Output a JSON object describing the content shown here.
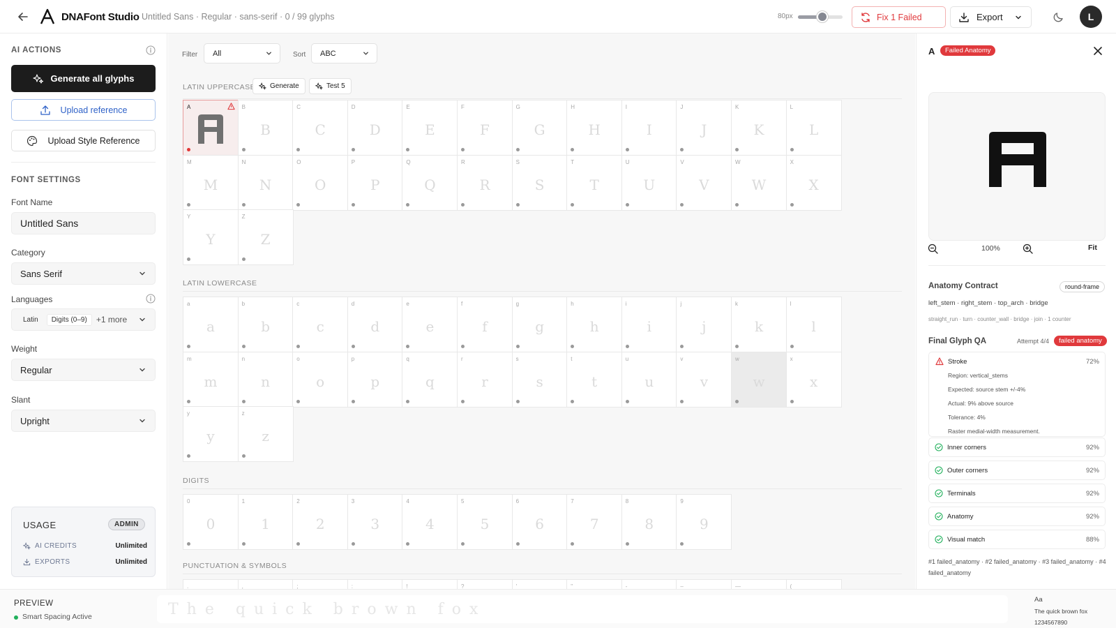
{
  "header": {
    "app_title": "DNAFont Studio",
    "doc_info": "Untitled Sans · Regular · sans-serif · 0 / 99 glyphs",
    "size_label": "80px",
    "size_fraction": 0.55,
    "fix_label": "Fix 1 Failed",
    "export_label": "Export",
    "avatar_letter": "L"
  },
  "sidebar": {
    "ai_heading": "AI ACTIONS",
    "generate_all": "Generate all glyphs",
    "upload_reference": "Upload reference",
    "upload_style": "Upload Style Reference",
    "settings_heading": "FONT SETTINGS",
    "font_name_label": "Font Name",
    "font_name_value": "Untitled Sans",
    "category_label": "Category",
    "category_value": "Sans Serif",
    "languages_label": "Languages",
    "languages_chips": [
      "Latin",
      "Digits (0–9)"
    ],
    "languages_more": "+1 more",
    "weight_label": "Weight",
    "weight_value": "Regular",
    "slant_label": "Slant",
    "slant_value": "Upright",
    "usage": {
      "title": "USAGE",
      "badge": "ADMIN",
      "credits_label": "AI CREDITS",
      "credits_value": "Unlimited",
      "exports_label": "EXPORTS",
      "exports_value": "Unlimited"
    }
  },
  "toolbar": {
    "filter_label": "Filter",
    "filter_value": "All",
    "sort_label": "Sort",
    "sort_value": "ABC"
  },
  "sections": [
    {
      "title": "LATIN UPPERCASE",
      "generate": "Generate",
      "test": "Test 5",
      "glyphs": [
        "A",
        "B",
        "C",
        "D",
        "E",
        "F",
        "G",
        "H",
        "I",
        "J",
        "K",
        "L",
        "M",
        "N",
        "O",
        "P",
        "Q",
        "R",
        "S",
        "T",
        "U",
        "V",
        "W",
        "X",
        "Y",
        "Z"
      ]
    },
    {
      "title": "LATIN LOWERCASE",
      "glyphs": [
        "a",
        "b",
        "c",
        "d",
        "e",
        "f",
        "g",
        "h",
        "i",
        "j",
        "k",
        "l",
        "m",
        "n",
        "o",
        "p",
        "q",
        "r",
        "s",
        "t",
        "u",
        "v",
        "w",
        "x",
        "y",
        "z"
      ]
    },
    {
      "title": "DIGITS",
      "glyphs": [
        "0",
        "1",
        "2",
        "3",
        "4",
        "5",
        "6",
        "7",
        "8",
        "9"
      ]
    },
    {
      "title": "PUNCTUATION & SYMBOLS",
      "glyphs": [
        ".",
        ",",
        ";",
        ":",
        "!",
        "?",
        "'",
        "\"",
        "-",
        "–",
        "—",
        "("
      ]
    }
  ],
  "panel": {
    "char": "A",
    "status_badge": "Failed Anatomy",
    "zoom_level": "100%",
    "fit": "Fit",
    "contract_title": "Anatomy Contract",
    "contract_badge": "round-frame",
    "contract_main": "left_stem · right_stem · top_arch · bridge",
    "contract_extra": "straight_run · turn · counter_wall · bridge · join · 1 counter",
    "qa_title": "Final Glyph QA",
    "qa_attempt": "Attempt 4/4",
    "qa_badge": "failed anatomy",
    "stroke": {
      "name": "Stroke",
      "score": "72%",
      "details": [
        "Region: vertical_stems",
        "Expected: source stem +/-4%",
        "Actual: 9% above source",
        "Tolerance: 4%",
        "Raster medial-width measurement."
      ]
    },
    "checks": [
      {
        "name": "Inner corners",
        "score": "92%"
      },
      {
        "name": "Outer corners",
        "score": "92%"
      },
      {
        "name": "Terminals",
        "score": "92%"
      },
      {
        "name": "Anatomy",
        "score": "92%"
      },
      {
        "name": "Visual match",
        "score": "88%"
      }
    ],
    "attempts": "#1 failed_anatomy · #2 failed_anatomy · #3 failed_anatomy · #4 failed_anatomy"
  },
  "bottom": {
    "preview_title": "PREVIEW",
    "spacing_label": "Smart Spacing Active",
    "preview_text": "The quick brown fox",
    "spec_aa": "Aa",
    "spec_sentence": "The quick brown fox",
    "spec_digits": "1234567890"
  },
  "colors": {
    "accent_red": "#e0393c",
    "accent_blue": "#2f62c8",
    "success_green": "#22b05c",
    "dark_button": "#1c1c1c"
  }
}
